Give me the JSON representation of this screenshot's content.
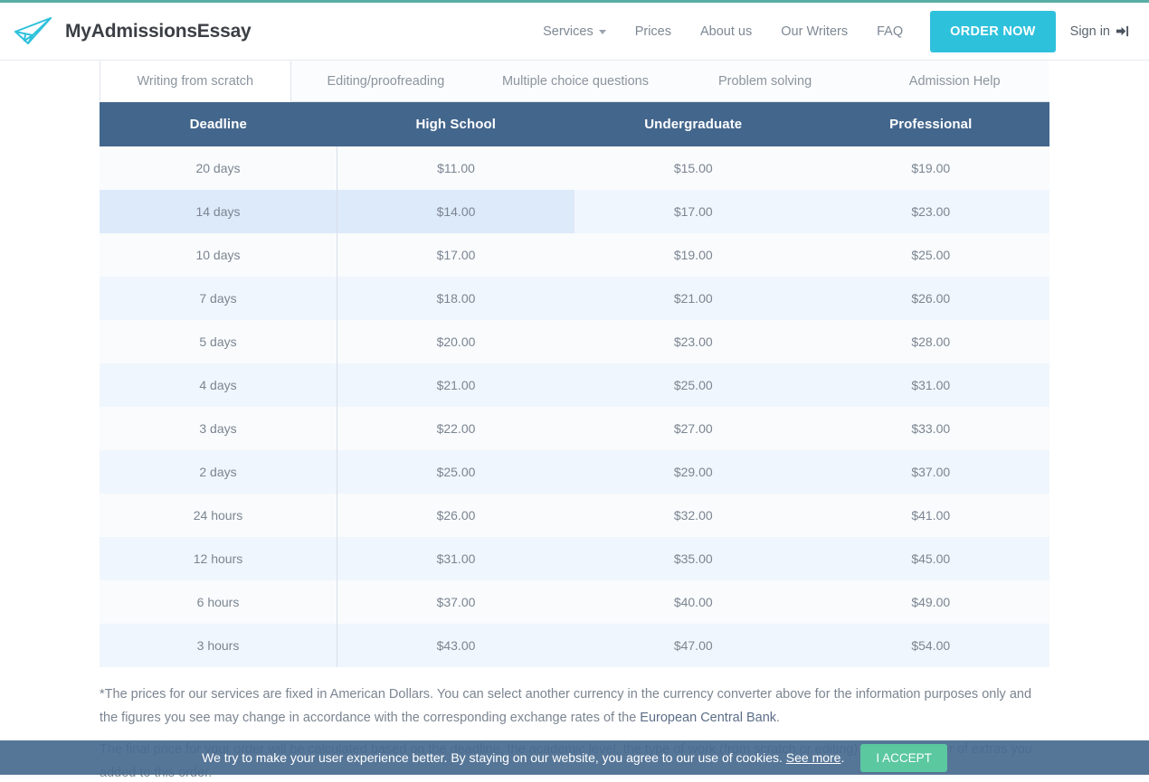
{
  "theme": {
    "accent_top": "#5aada4",
    "brand_cyan": "#2ec1dc",
    "table_header": "#43668c",
    "row_even": "#f0f6fd",
    "row_odd": "#f9fbfd",
    "highlight": "#ddeafa",
    "accept_green": "#5bc8a0",
    "cookie_bar": "#486a8f"
  },
  "header": {
    "logo_icon": "paper-plane-icon",
    "brand": "MyAdmissionsEssay",
    "nav": [
      {
        "label": "Services",
        "has_caret": true
      },
      {
        "label": "Prices",
        "has_caret": false
      },
      {
        "label": "About us",
        "has_caret": false
      },
      {
        "label": "Our Writers",
        "has_caret": false
      },
      {
        "label": "FAQ",
        "has_caret": false
      }
    ],
    "order_now": "ORDER NOW",
    "signin": "Sign in",
    "signin_icon": "sign-in-arrow-icon"
  },
  "tabs": [
    {
      "label": "Writing from scratch",
      "active": true
    },
    {
      "label": "Editing/proofreading",
      "active": false
    },
    {
      "label": "Multiple choice questions",
      "active": false
    },
    {
      "label": "Problem solving",
      "active": false
    },
    {
      "label": "Admission Help",
      "active": false
    }
  ],
  "table": {
    "columns": [
      "Deadline",
      "High School",
      "Undergraduate",
      "Professional"
    ],
    "highlight_row_index": 1,
    "highlight_col_index": 1,
    "rows": [
      {
        "deadline": "20 days",
        "high_school": "$11.00",
        "undergraduate": "$15.00",
        "professional": "$19.00"
      },
      {
        "deadline": "14 days",
        "high_school": "$14.00",
        "undergraduate": "$17.00",
        "professional": "$23.00"
      },
      {
        "deadline": "10 days",
        "high_school": "$17.00",
        "undergraduate": "$19.00",
        "professional": "$25.00"
      },
      {
        "deadline": "7 days",
        "high_school": "$18.00",
        "undergraduate": "$21.00",
        "professional": "$26.00"
      },
      {
        "deadline": "5 days",
        "high_school": "$20.00",
        "undergraduate": "$23.00",
        "professional": "$28.00"
      },
      {
        "deadline": "4 days",
        "high_school": "$21.00",
        "undergraduate": "$25.00",
        "professional": "$31.00"
      },
      {
        "deadline": "3 days",
        "high_school": "$22.00",
        "undergraduate": "$27.00",
        "professional": "$33.00"
      },
      {
        "deadline": "2 days",
        "high_school": "$25.00",
        "undergraduate": "$29.00",
        "professional": "$37.00"
      },
      {
        "deadline": "24 hours",
        "high_school": "$26.00",
        "undergraduate": "$32.00",
        "professional": "$41.00"
      },
      {
        "deadline": "12 hours",
        "high_school": "$31.00",
        "undergraduate": "$35.00",
        "professional": "$45.00"
      },
      {
        "deadline": "6 hours",
        "high_school": "$37.00",
        "undergraduate": "$40.00",
        "professional": "$49.00"
      },
      {
        "deadline": "3 hours",
        "high_school": "$43.00",
        "undergraduate": "$47.00",
        "professional": "$54.00"
      }
    ]
  },
  "footnote": {
    "text_before_link": "*The prices for our services are fixed in American Dollars. You can select another currency in the currency converter above for the information purposes only and the figures you see may change in accordance with the corresponding exchange rates of the ",
    "link_label": "European Central Bank",
    "text_after_link": "."
  },
  "paragraph2": {
    "text": "The final price for your order will be calculated based on the deadline, the academic level, the type of work (from scratch or editing) and the number of extras you added to this order."
  },
  "cookie": {
    "text_before_link": "We try to make your user experience better. By staying on our website, you agree to our use of cookies. ",
    "link_label": "See more",
    "text_after_link": ".",
    "accept_label": "I ACCEPT"
  }
}
